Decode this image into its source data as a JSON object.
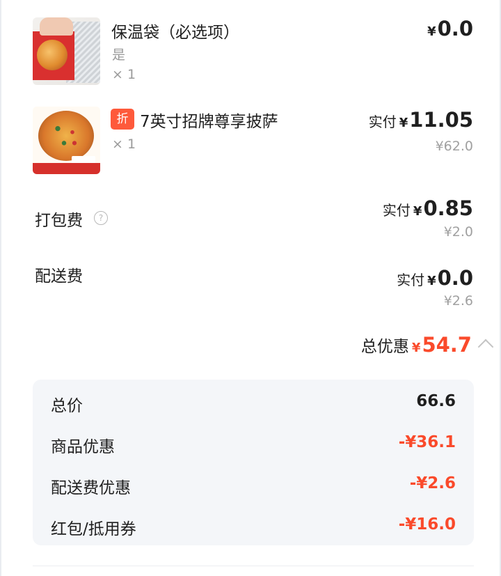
{
  "items": [
    {
      "name": "保温袋（必选项）",
      "option": "是",
      "qty": "× 1",
      "yen": "¥",
      "price": "0.0"
    },
    {
      "badge": "折",
      "name": "7英寸招牌尊享披萨",
      "qty": "× 1",
      "paid_label": "实付",
      "yen": "¥",
      "price": "11.05",
      "original": "¥62.0"
    }
  ],
  "fees": [
    {
      "label": "打包费",
      "help_icon": "?",
      "paid_label": "实付",
      "yen": "¥",
      "price": "0.85",
      "original": "¥2.0"
    },
    {
      "label": "配送费",
      "paid_label": "实付",
      "yen": "¥",
      "price": "0.0",
      "original": "¥2.6"
    }
  ],
  "total_discount": {
    "label": "总优惠",
    "yen": "¥",
    "amount": "54.7"
  },
  "summary": [
    {
      "label": "总价",
      "value": "66.6"
    },
    {
      "label": "商品优惠",
      "value": "-¥36.1"
    },
    {
      "label": "配送费优惠",
      "value": "-¥2.6"
    },
    {
      "label": "红包/抵用券",
      "value": "-¥16.0"
    }
  ],
  "colors": {
    "accent_red": "#fa4a2b",
    "badge_orange": "#fe5a3b",
    "panel_bg": "#f4f6f9"
  }
}
